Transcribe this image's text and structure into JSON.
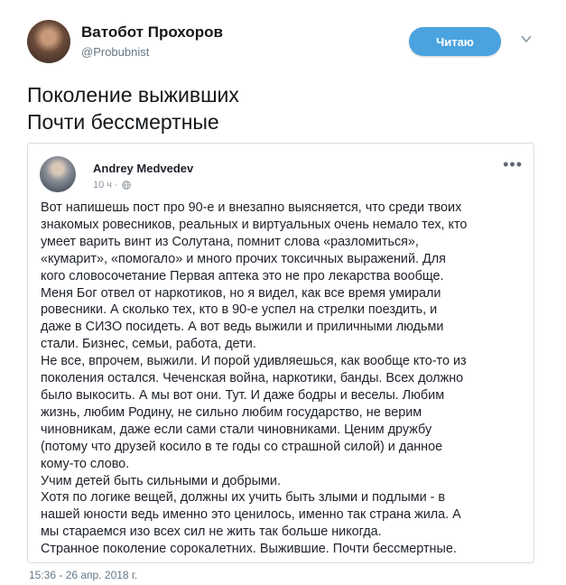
{
  "tweet": {
    "author_name": "Ватобот Прохоров",
    "author_handle": "@Probubnist",
    "follow_label": "Читаю",
    "text_lines": [
      "Поколение выживших",
      "Почти бессмертные"
    ],
    "timestamp": "15:36 - 26 апр. 2018 г."
  },
  "quoted_post": {
    "author": "Andrey Medvedev",
    "time": "10 ч ·",
    "more_label": "•••",
    "lines": [
      "Вот напишешь пост про 90-е и внезапно выясняется, что среди твоих",
      "знакомых ровесников, реальных и виртуальных очень немало тех, кто",
      "умеет варить винт из Солутана, помнит слова «разломиться»,",
      "«кумарит», «помогало» и много прочих токсичных выражений. Для",
      "кого словосочетание Первая аптека это не про лекарства вообще.",
      "Меня Бог отвел от наркотиков, но я видел, как все время умирали",
      "ровесники. А сколько тех, кто в 90-е успел на стрелки поездить, и",
      "даже в СИЗО посидеть. А вот ведь выжили и приличными людьми",
      "стали. Бизнес, семьи, работа, дети.",
      "Не все, впрочем, выжили. И порой удивляешься, как вообще кто-то из",
      "поколения остался. Чеченская война, наркотики, банды. Всех должно",
      "было выкосить. А мы вот они. Тут. И даже бодры и веселы. Любим",
      "жизнь, любим Родину, не сильно любим государство, не верим",
      "чиновникам, даже если сами стали чиновниками. Ценим дружбу",
      "(потому что друзей косило в те годы со страшной силой) и данное",
      "кому-то слово.",
      "Учим детей быть сильными и добрыми.",
      "Хотя по логике вещей, должны их учить быть злыми и подлыми - в",
      "нашей юности ведь именно это ценилось, именно так страна жила. А",
      "мы стараемся изо всех сил не жить так больше никогда.",
      "Странное поколение сорокалетних. Выжившие. Почти бессмертные."
    ]
  },
  "icons": {
    "chevron": "chevron-down-icon",
    "globe": "globe-icon",
    "more": "more-dots-icon"
  },
  "colors": {
    "follow_button": "#4aa3df",
    "secondary_text": "#657786",
    "card_border": "#d8dde2"
  }
}
